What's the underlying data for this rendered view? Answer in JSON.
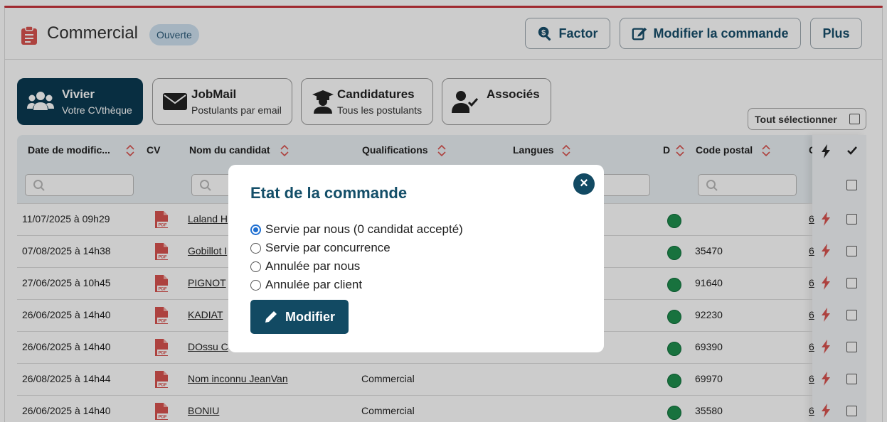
{
  "colors": {
    "brand": "#124a63",
    "accent_red": "#c7343b",
    "status_green": "#1e8f4e",
    "badge_bg": "#cfe2f1"
  },
  "header": {
    "title": "Commercial",
    "status": "Ouverte",
    "buttons": {
      "factor": "Factor",
      "modify_order": "Modifier la commande",
      "more": "Plus"
    }
  },
  "tabs": [
    {
      "label": "Vivier",
      "sub": "Votre CVthèque",
      "icon": "users-icon",
      "active": true
    },
    {
      "label": "JobMail",
      "sub": "Postulants par email",
      "icon": "envelope-icon",
      "active": false
    },
    {
      "label": "Candidatures",
      "sub": "Tous les postulants",
      "icon": "graduate-icon",
      "active": false
    },
    {
      "label": "Associés",
      "sub": "",
      "icon": "user-check-icon",
      "active": false
    }
  ],
  "select_all_label": "Tout sélectionner",
  "table": {
    "columns": {
      "date": "Date de modific...",
      "cv": "CV",
      "name": "Nom du candidat",
      "qualifications": "Qualifications",
      "languages": "Langues",
      "d": "D",
      "postal": "Code postal",
      "next": "C"
    },
    "rows": [
      {
        "date": "11/07/2025 à 09h29",
        "name": "Laland H",
        "qualification": "",
        "postal": "",
        "extra": "6"
      },
      {
        "date": "07/08/2025 à 14h38",
        "name": "Gobillot I",
        "qualification": "",
        "postal": "35470",
        "extra": "6"
      },
      {
        "date": "27/06/2025 à 10h45",
        "name": "PIGNOT",
        "qualification": "",
        "postal": "91640",
        "extra": "6"
      },
      {
        "date": "26/06/2025 à 14h40",
        "name": "KADIAT",
        "qualification": "",
        "postal": "92230",
        "extra": "6"
      },
      {
        "date": "26/06/2025 à 14h40",
        "name": "DOssu C",
        "qualification": "",
        "postal": "69390",
        "extra": "6"
      },
      {
        "date": "26/08/2025 à 14h44",
        "name": "Nom inconnu JeanVan",
        "qualification": "Commercial",
        "postal": "69970",
        "extra": "6"
      },
      {
        "date": "26/06/2025 à 14h40",
        "name": "BONIU",
        "qualification": "Commercial",
        "postal": "35580",
        "extra": "6"
      }
    ]
  },
  "modal": {
    "title": "Etat de la commande",
    "options": [
      {
        "label": "Servie par nous (0 candidat accepté)",
        "checked": true
      },
      {
        "label": "Servie par concurrence",
        "checked": false
      },
      {
        "label": "Annulée par nous",
        "checked": false
      },
      {
        "label": "Annulée par client",
        "checked": false
      }
    ],
    "submit": "Modifier",
    "close": "×"
  }
}
